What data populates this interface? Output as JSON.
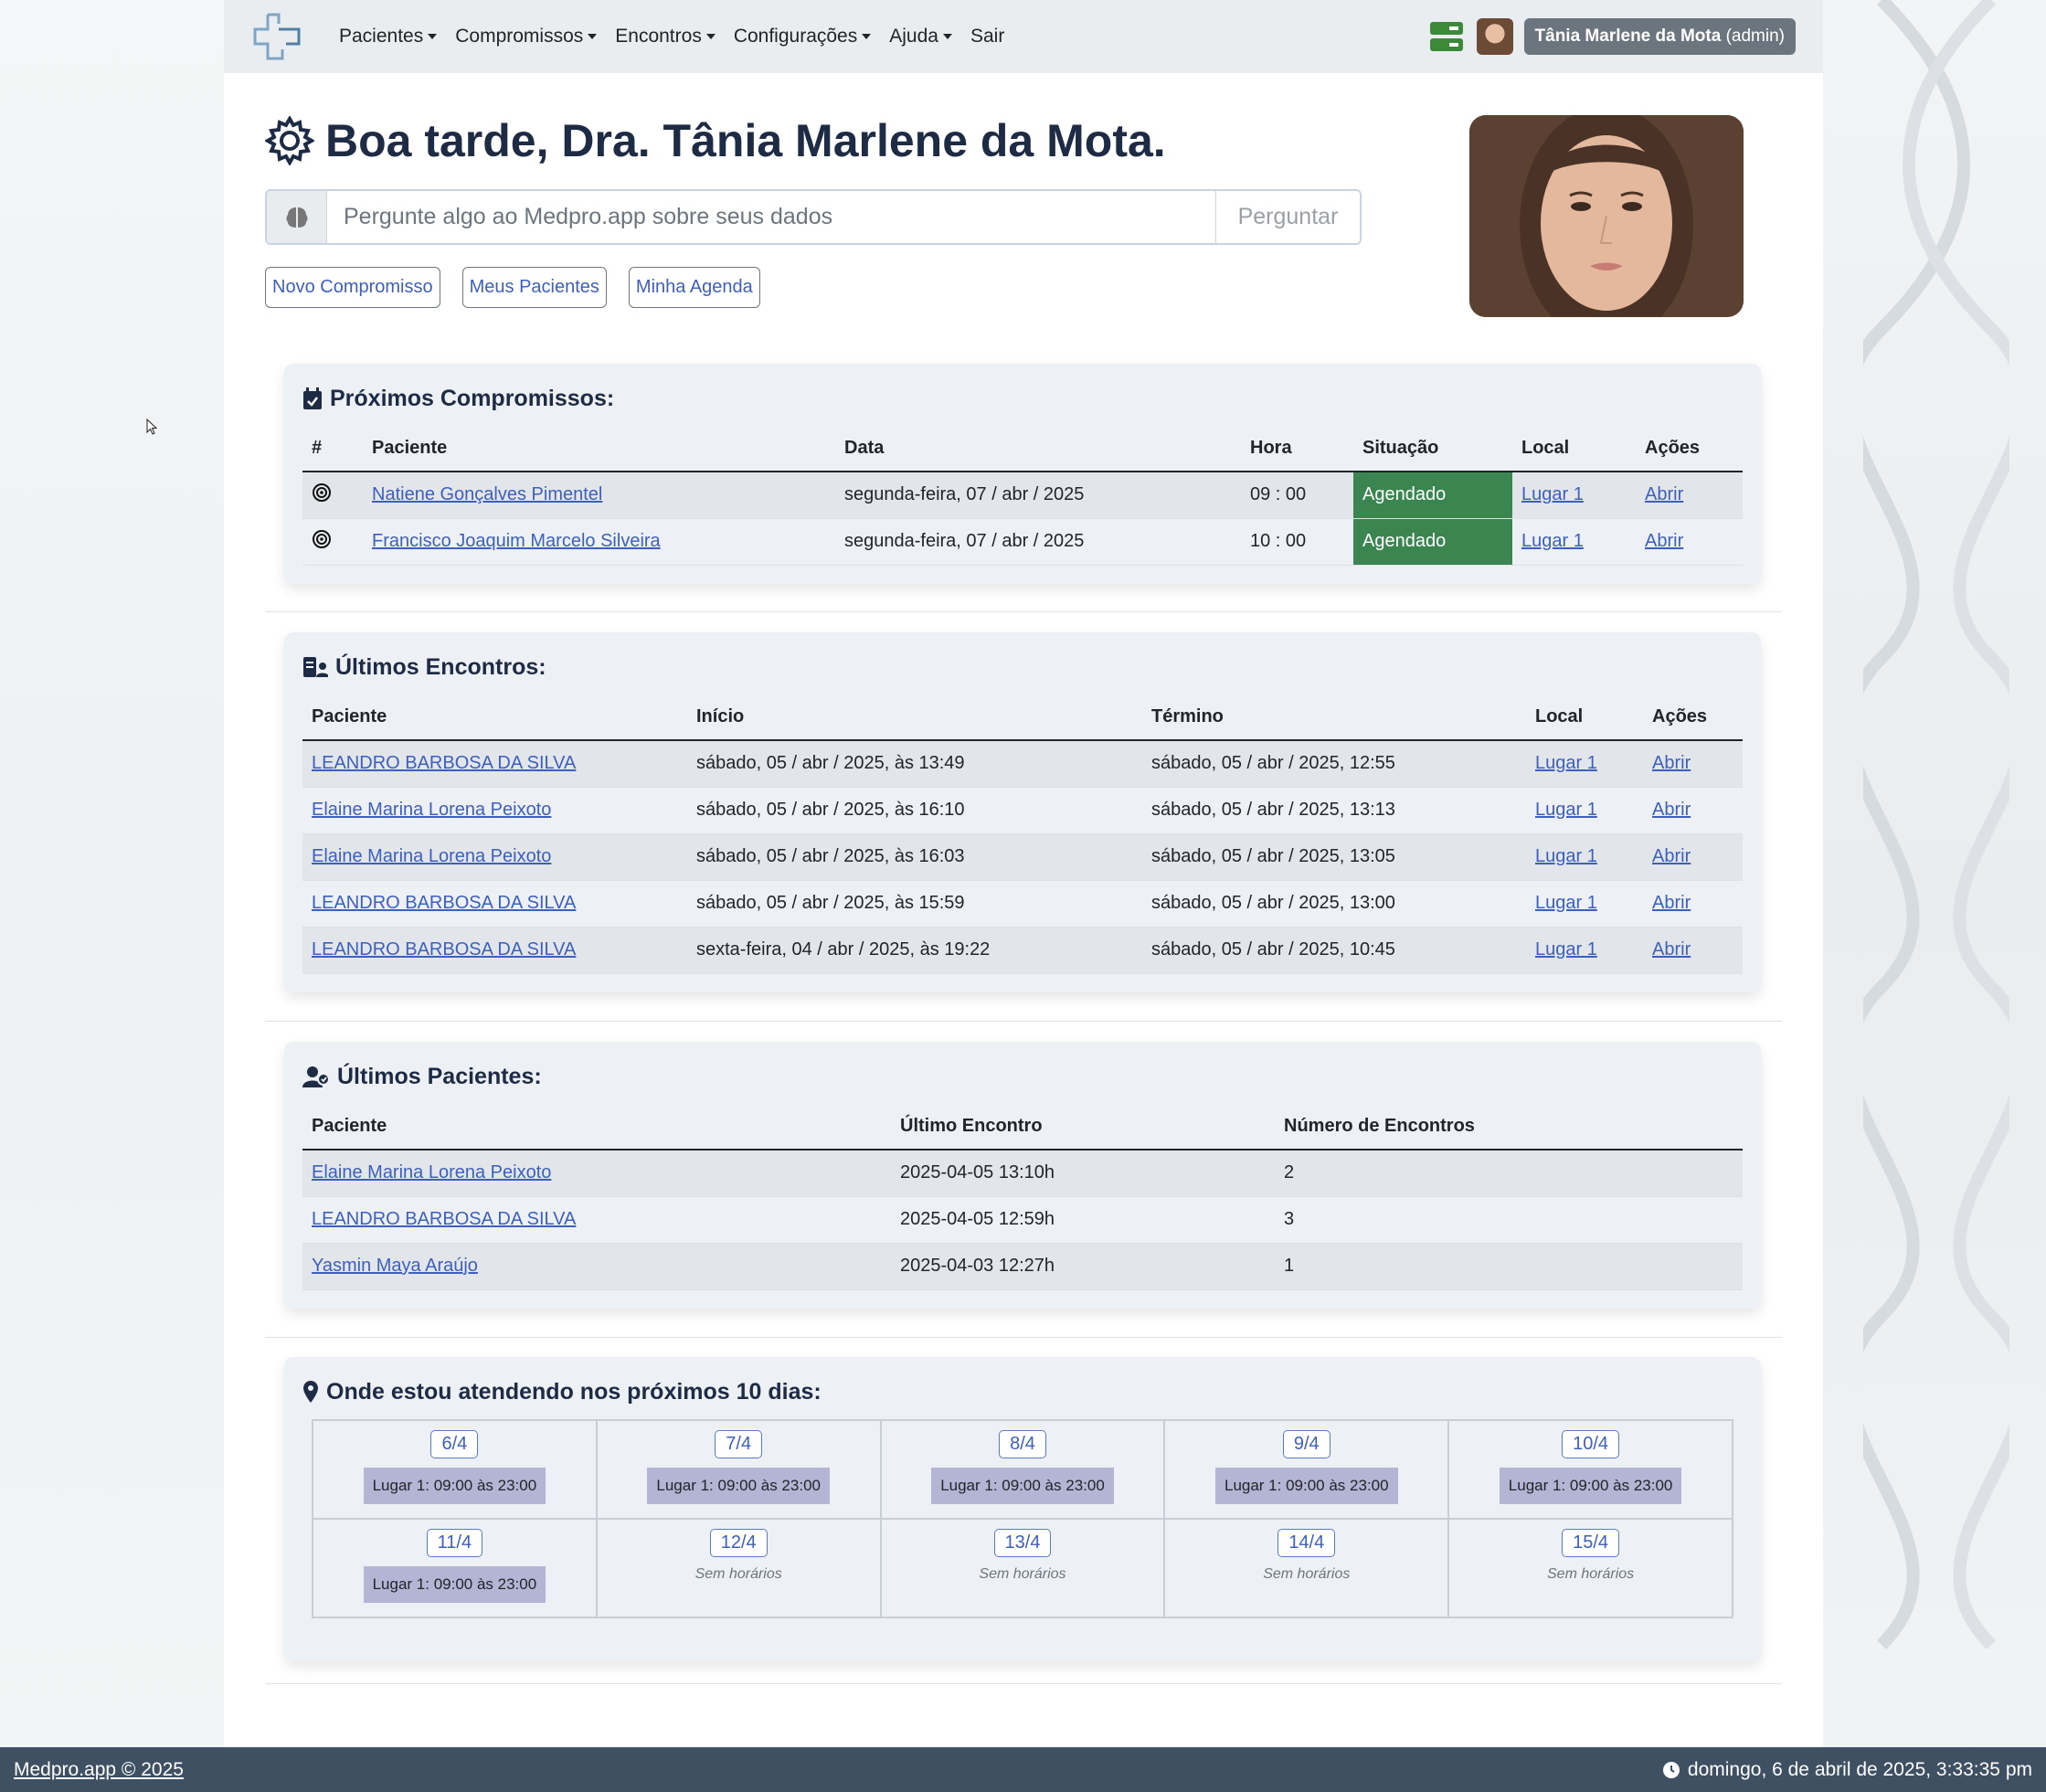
{
  "nav": {
    "items": [
      {
        "label": "Pacientes",
        "dropdown": true
      },
      {
        "label": "Compromissos",
        "dropdown": true
      },
      {
        "label": "Encontros",
        "dropdown": true
      },
      {
        "label": "Configurações",
        "dropdown": true
      },
      {
        "label": "Ajuda",
        "dropdown": true
      },
      {
        "label": "Sair",
        "dropdown": false
      }
    ],
    "user_name": "Tânia Marlene da Mota",
    "user_role": "(admin)"
  },
  "header": {
    "greeting": "Boa tarde, Dra. Tânia Marlene da Mota.",
    "ask_placeholder": "Pergunte algo ao Medpro.app sobre seus dados",
    "ask_button": "Perguntar",
    "quick_links": [
      "Novo Compromisso",
      "Meus Pacientes",
      "Minha Agenda"
    ]
  },
  "appointments": {
    "title": "Próximos Compromissos:",
    "columns": [
      "#",
      "Paciente",
      "Data",
      "Hora",
      "Situação",
      "Local",
      "Ações"
    ],
    "rows": [
      {
        "patient": "Natiene Gonçalves Pimentel",
        "date": "segunda-feira, 07 / abr / 2025",
        "time": "09 : 00",
        "status": "Agendado",
        "place": "Lugar 1",
        "action": "Abrir"
      },
      {
        "patient": "Francisco Joaquim Marcelo Silveira",
        "date": "segunda-feira, 07 / abr / 2025",
        "time": "10 : 00",
        "status": "Agendado",
        "place": "Lugar 1",
        "action": "Abrir"
      }
    ]
  },
  "encounters": {
    "title": "Últimos Encontros:",
    "columns": [
      "Paciente",
      "Início",
      "Término",
      "Local",
      "Ações"
    ],
    "rows": [
      {
        "patient": "LEANDRO BARBOSA DA SILVA",
        "start": "sábado, 05 / abr / 2025, às 13:49",
        "end": "sábado, 05 / abr / 2025, 12:55",
        "place": "Lugar 1",
        "action": "Abrir"
      },
      {
        "patient": "Elaine Marina Lorena Peixoto",
        "start": "sábado, 05 / abr / 2025, às 16:10",
        "end": "sábado, 05 / abr / 2025, 13:13",
        "place": "Lugar 1",
        "action": "Abrir"
      },
      {
        "patient": "Elaine Marina Lorena Peixoto",
        "start": "sábado, 05 / abr / 2025, às 16:03",
        "end": "sábado, 05 / abr / 2025, 13:05",
        "place": "Lugar 1",
        "action": "Abrir"
      },
      {
        "patient": "LEANDRO BARBOSA DA SILVA",
        "start": "sábado, 05 / abr / 2025, às 15:59",
        "end": "sábado, 05 / abr / 2025, 13:00",
        "place": "Lugar 1",
        "action": "Abrir"
      },
      {
        "patient": "LEANDRO BARBOSA DA SILVA",
        "start": "sexta-feira, 04 / abr / 2025, às 19:22",
        "end": "sábado, 05 / abr / 2025, 10:45",
        "place": "Lugar 1",
        "action": "Abrir"
      }
    ]
  },
  "patients": {
    "title": "Últimos Pacientes:",
    "columns": [
      "Paciente",
      "Último Encontro",
      "Número de Encontros"
    ],
    "rows": [
      {
        "patient": "Elaine Marina Lorena Peixoto",
        "last": "2025-04-05 13:10h",
        "count": "2"
      },
      {
        "patient": "LEANDRO BARBOSA DA SILVA",
        "last": "2025-04-05 12:59h",
        "count": "3"
      },
      {
        "patient": "Yasmin Maya Araújo",
        "last": "2025-04-03 12:27h",
        "count": "1"
      }
    ]
  },
  "schedule": {
    "title": "Onde estou atendendo nos próximos 10 dias:",
    "days": [
      {
        "day": "6/4",
        "slot": "Lugar 1: 09:00 às 23:00"
      },
      {
        "day": "7/4",
        "slot": "Lugar 1: 09:00 às 23:00"
      },
      {
        "day": "8/4",
        "slot": "Lugar 1: 09:00 às 23:00"
      },
      {
        "day": "9/4",
        "slot": "Lugar 1: 09:00 às 23:00"
      },
      {
        "day": "10/4",
        "slot": "Lugar 1: 09:00 às 23:00"
      },
      {
        "day": "11/4",
        "slot": "Lugar 1: 09:00 às 23:00"
      },
      {
        "day": "12/4",
        "slot": null,
        "empty": "Sem horários"
      },
      {
        "day": "13/4",
        "slot": null,
        "empty": "Sem horários"
      },
      {
        "day": "14/4",
        "slot": null,
        "empty": "Sem horários"
      },
      {
        "day": "15/4",
        "slot": null,
        "empty": "Sem horários"
      }
    ]
  },
  "footer": {
    "copyright": "Medpro.app © 2025",
    "datetime": "domingo, 6 de abril de 2025, 3:33:35 pm"
  },
  "colors": {
    "status_green": "#3a8550",
    "link_blue": "#3d5fbd",
    "footer_bg": "#3e5061",
    "slot_bg": "#b4b4d4"
  },
  "icons": [
    "logo-cross-icon",
    "server-icon",
    "gear-icon",
    "brain-icon",
    "calendar-check-icon",
    "target-icon",
    "encounter-icon",
    "user-group-icon",
    "map-pin-icon",
    "clock-icon"
  ]
}
